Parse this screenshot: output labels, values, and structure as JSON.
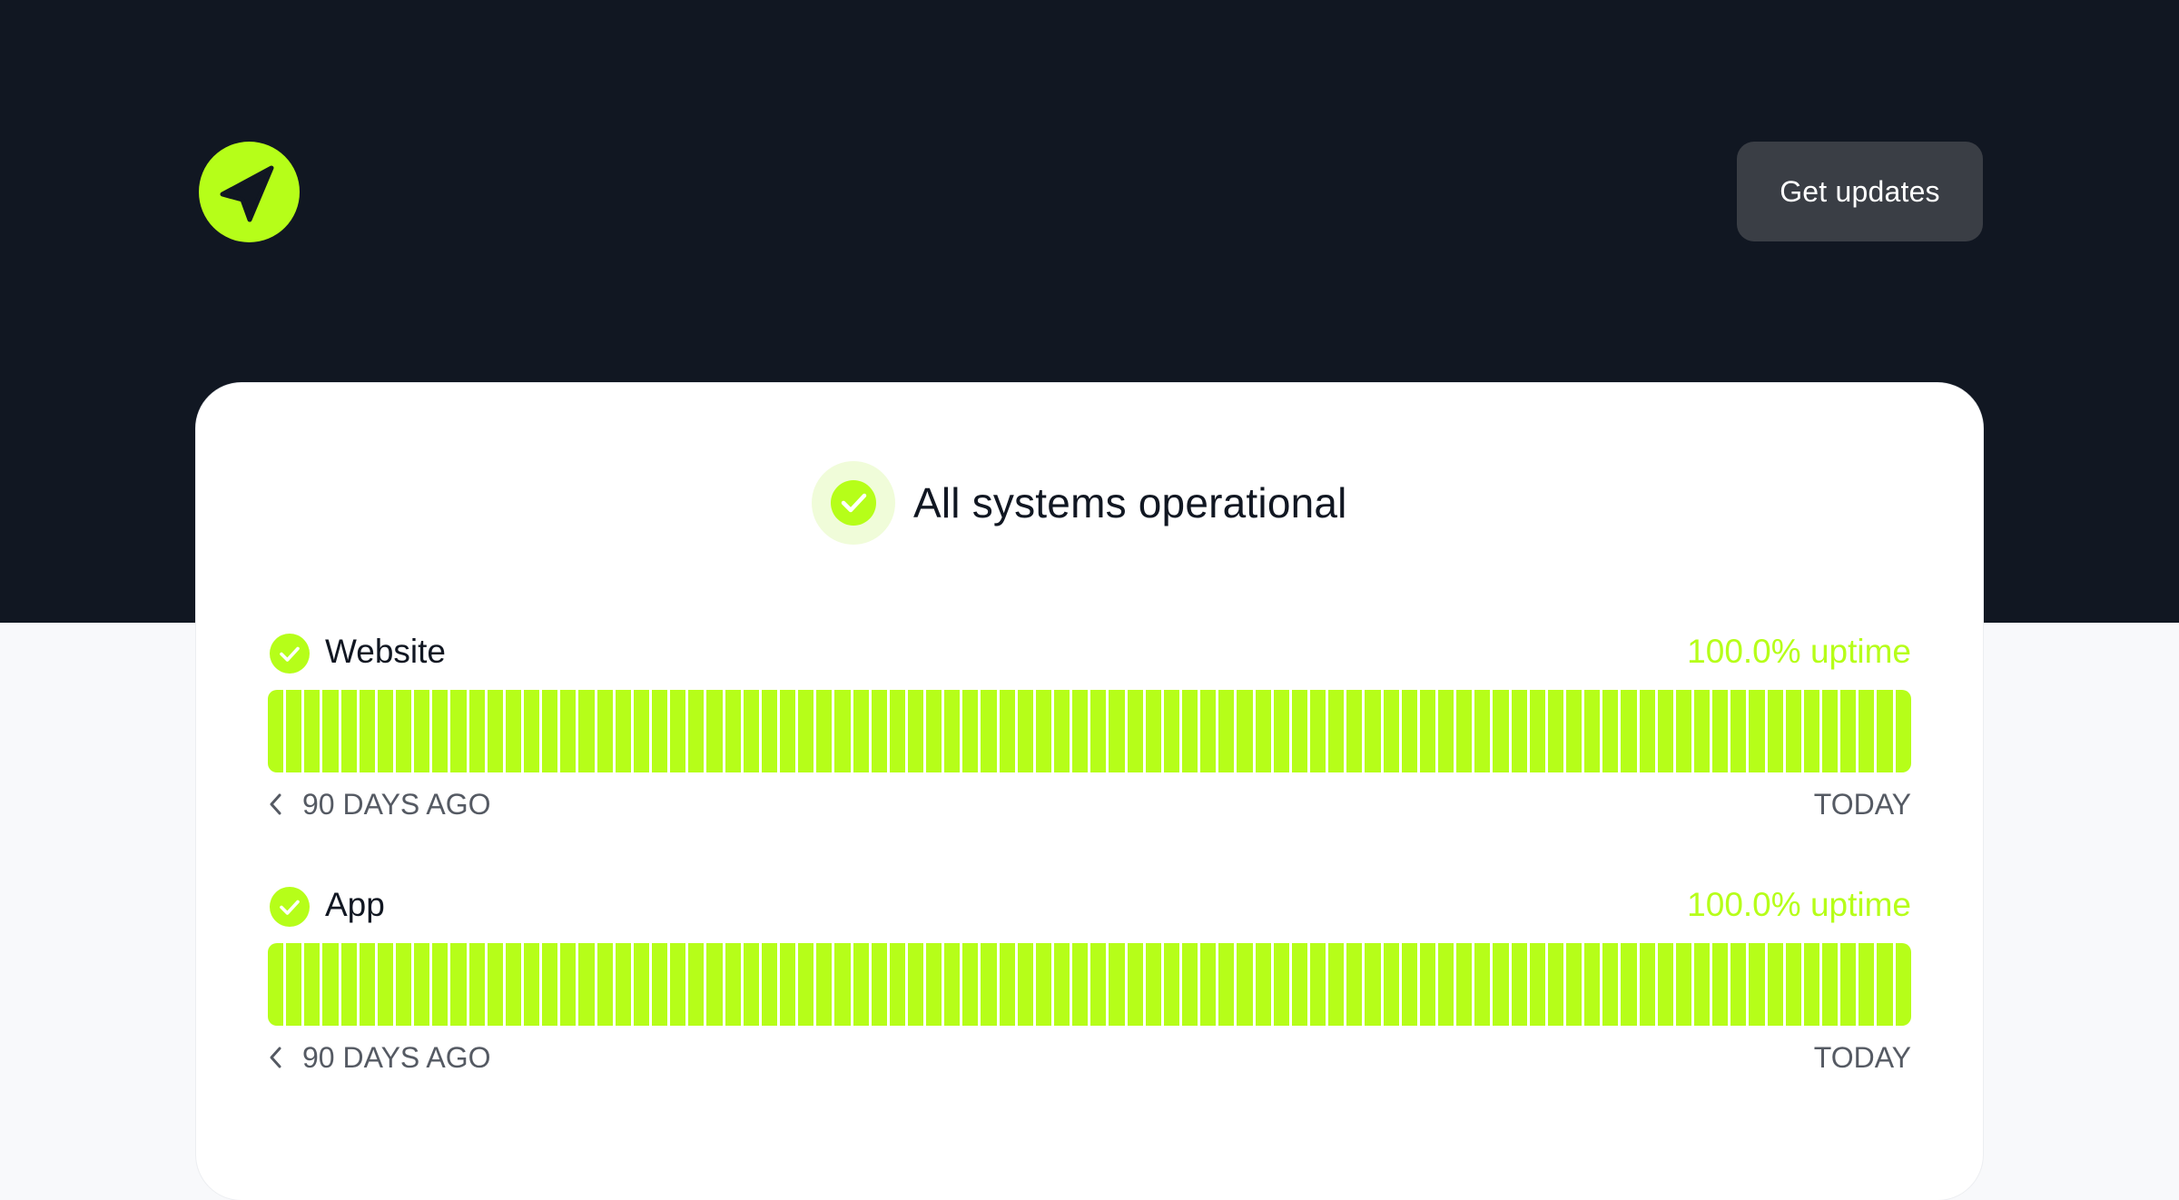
{
  "header": {
    "logo_icon": "navigation-arrow-icon",
    "get_updates_label": "Get updates",
    "brand_color": "#b6fe19",
    "background_color": "#111722"
  },
  "overall_status": {
    "icon": "check-circle-icon",
    "text": "All systems operational"
  },
  "components": [
    {
      "name": "Website",
      "uptime": "100.0% uptime",
      "days": 90,
      "day_statuses": "all operational",
      "range_start": "90 DAYS AGO",
      "range_end": "TODAY"
    },
    {
      "name": "App",
      "uptime": "100.0% uptime",
      "days": 90,
      "day_statuses": "all operational",
      "range_start": "90 DAYS AGO",
      "range_end": "TODAY"
    }
  ]
}
